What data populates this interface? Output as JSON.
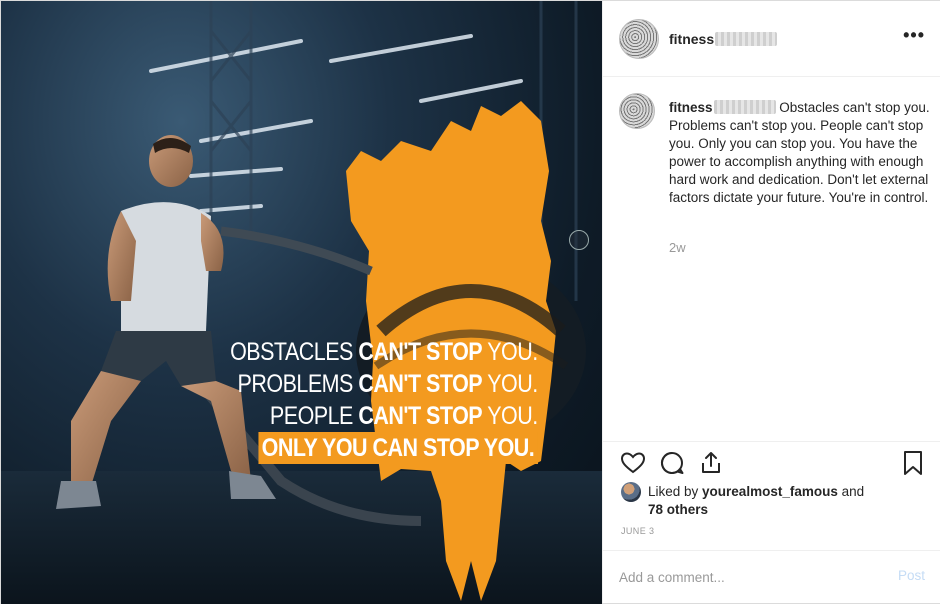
{
  "post": {
    "image": {
      "quote_lines": [
        {
          "thin": "OBSTACLES ",
          "bold": "CAN'T STOP",
          "tail": " YOU."
        },
        {
          "thin": "PROBLEMS ",
          "bold": "CAN'T STOP",
          "tail": " YOU."
        },
        {
          "thin": "PEOPLE ",
          "bold": "CAN'T STOP",
          "tail": " YOU."
        }
      ],
      "highlight_line": "ONLY YOU CAN STOP YOU.",
      "accent_color": "#f39a1f"
    },
    "header": {
      "username": "fitness",
      "more_icon": "more-horizontal-icon",
      "more_label": "•••"
    },
    "caption": {
      "username": "fitness",
      "text": "Obstacles can't stop you. Problems can't stop you. People can't stop you. Only you can stop you. You have the power to accomplish anything with enough hard work and dedication. Don't let external factors dictate your future. You're in control.",
      "time": "2w"
    },
    "actions": {
      "icons": [
        "heart-icon",
        "comment-icon",
        "share-icon",
        "bookmark-icon"
      ]
    },
    "likes": {
      "prefix": "Liked by ",
      "user": "yourealmost_famous",
      "and": " and",
      "others": "78 others"
    },
    "date": "JUNE 3",
    "comment": {
      "placeholder": "Add a comment...",
      "post_label": "Post"
    }
  }
}
